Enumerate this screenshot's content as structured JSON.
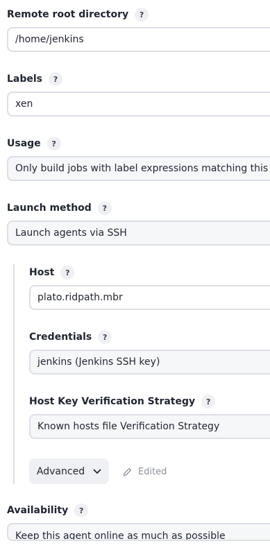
{
  "fields": {
    "remote_root": {
      "label": "Remote root directory",
      "help": "?",
      "value": "/home/jenkins"
    },
    "labels": {
      "label": "Labels",
      "help": "?",
      "value": "xen"
    },
    "usage": {
      "label": "Usage",
      "help": "?",
      "value": "Only build jobs with label expressions matching this node"
    },
    "launch_method": {
      "label": "Launch method",
      "help": "?",
      "value": "Launch agents via SSH"
    },
    "host": {
      "label": "Host",
      "help": "?",
      "value": "plato.ridpath.mbr"
    },
    "credentials": {
      "label": "Credentials",
      "help": "?",
      "value": "jenkins (Jenkins SSH key)"
    },
    "host_key": {
      "label": "Host Key Verification Strategy",
      "help": "?",
      "value": "Known hosts file Verification Strategy"
    },
    "availability": {
      "label": "Availability",
      "help": "?",
      "value": "Keep this agent online as much as possible"
    }
  },
  "advanced": {
    "label": "Advanced",
    "icon": "chevron-down-icon"
  },
  "edited": {
    "label": "Edited",
    "icon": "pencil-icon"
  }
}
